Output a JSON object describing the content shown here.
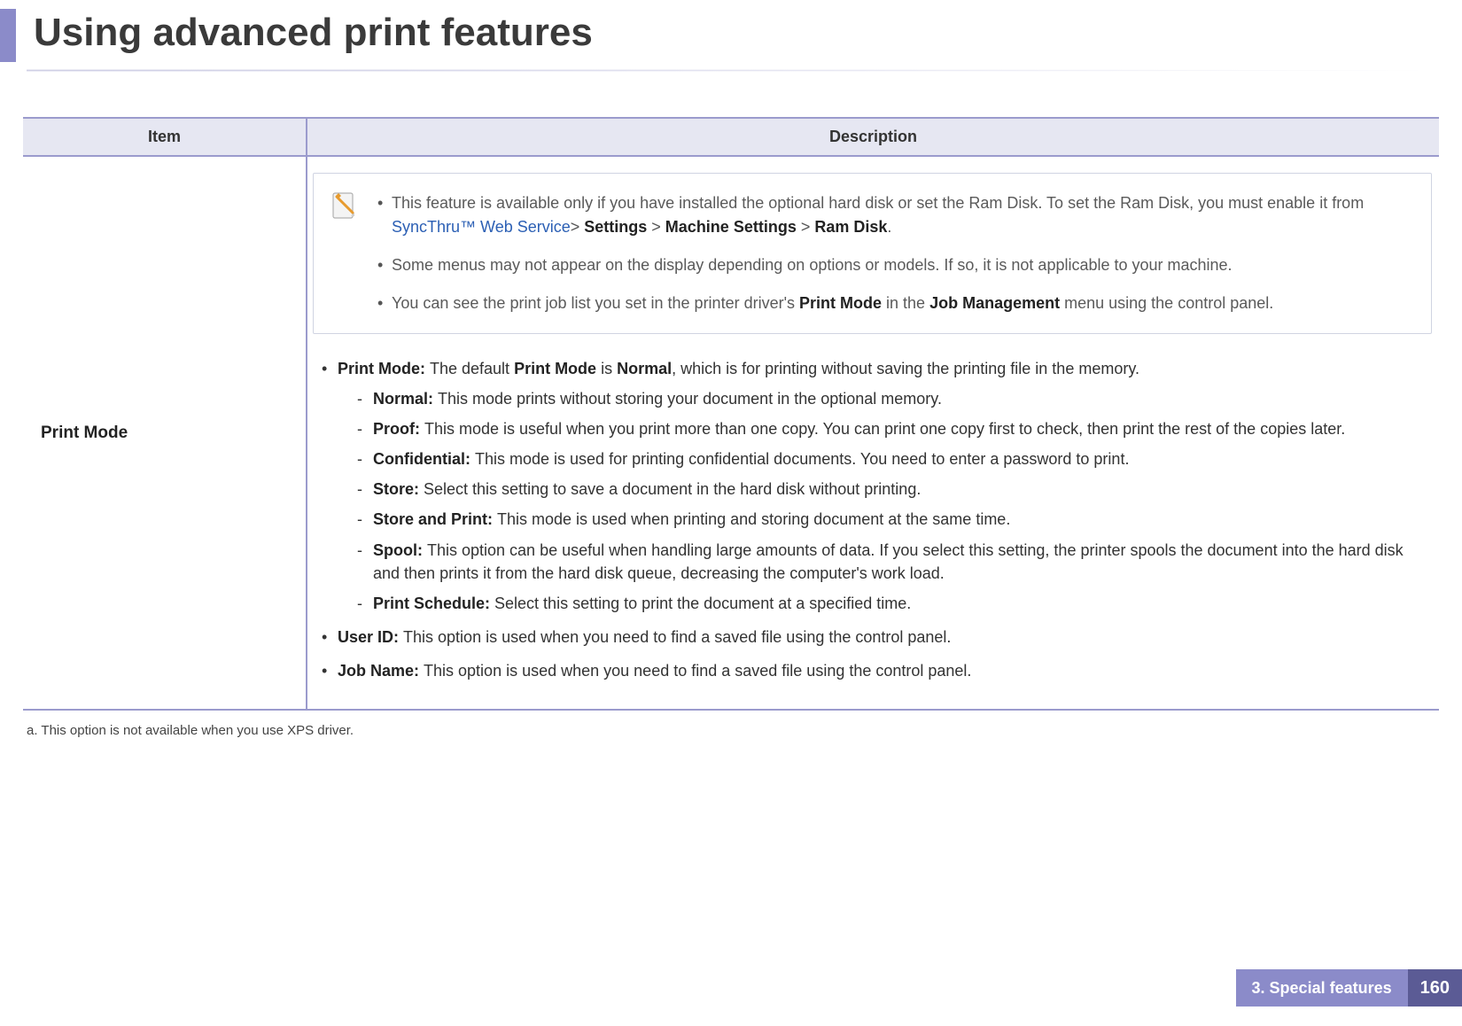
{
  "header": {
    "title": "Using advanced print features"
  },
  "table": {
    "columns": {
      "item": "Item",
      "description": "Description"
    },
    "row": {
      "item_label": "Print Mode",
      "note": {
        "li1_pre": " This feature is available only if you have installed the optional hard disk or set the Ram Disk. To set the Ram Disk, you must enable it from ",
        "li1_link": "SyncThru™ Web Service",
        "li1_gt1": ">",
        "li1_b1": " Settings ",
        "li1_gt2": ">",
        "li1_b2": " Machine Settings ",
        "li1_gt3": "> ",
        "li1_b3": "Ram Disk",
        "li1_tail": ".",
        "li2": "Some menus may not appear on the display depending on options or models. If so, it is not applicable to your machine.",
        "li3_pre": "You can see the print job list you set in the printer driver's ",
        "li3_b1": "Print Mode",
        "li3_mid": " in the ",
        "li3_b2": "Job Management",
        "li3_tail": " menu using the control panel."
      },
      "main": {
        "pm_label": "Print Mode: ",
        "pm_text_pre": "The default ",
        "pm_text_b1": "Print Mode",
        "pm_text_mid": " is ",
        "pm_text_b2": "Normal",
        "pm_text_tail": ", which is for printing without saving the printing file in the memory.",
        "sub": {
          "normal_l": "Normal: ",
          "normal_t": "This mode prints without storing your document in the optional memory.",
          "proof_l": "Proof: ",
          "proof_t": "This mode is useful when you print more than one copy. You can print one copy first to check, then print the rest of the copies later.",
          "conf_l": "Confidential: ",
          "conf_t": "This mode is used for printing confidential documents. You need to enter a password to print.",
          "store_l": "Store: ",
          "store_t": "Select this setting to save a document in the hard disk without printing.",
          "sap_l": "Store and Print: ",
          "sap_t": "This mode is used when printing and storing document at the same time.",
          "spool_l": "Spool: ",
          "spool_t": "This option can be useful when handling large amounts of data. If you select this setting, the printer spools the document into the hard disk and then prints it from the hard disk queue, decreasing the computer's work load.",
          "sched_l": "Print Schedule: ",
          "sched_t": "Select this setting to print the document at a specified time."
        },
        "userid_l": "User ID: ",
        "userid_t": "This option is used when you need to find a saved file using the control panel.",
        "jobname_l": "Job Name: ",
        "jobname_t": "This option is used when you need to find a saved file using the control panel."
      }
    }
  },
  "footnote": "a.  This option is not available when you use XPS driver.",
  "footer": {
    "section": "3.  Special features",
    "page": "160"
  }
}
